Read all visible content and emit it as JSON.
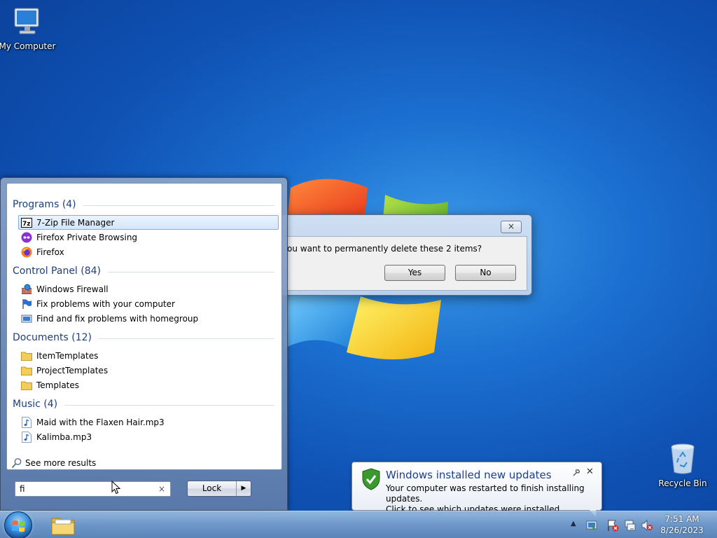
{
  "desktop": {
    "icons": [
      {
        "label": "My Computer"
      },
      {
        "label": "Recycle Bin"
      }
    ]
  },
  "dialog": {
    "message": "ou want to permanently delete these 2 items?",
    "yes_label": "Yes",
    "no_label": "No",
    "close_glyph": "×"
  },
  "start_menu": {
    "groups": [
      {
        "header": "Programs (4)",
        "items": [
          {
            "label": "7-Zip File Manager",
            "icon": "7zip-icon",
            "selected": true
          },
          {
            "label": "Firefox Private Browsing",
            "icon": "firefox-private-icon"
          },
          {
            "label": "Firefox",
            "icon": "firefox-icon"
          }
        ]
      },
      {
        "header": "Control Panel (84)",
        "items": [
          {
            "label": "Windows Firewall",
            "icon": "firewall-icon"
          },
          {
            "label": "Fix problems with your computer",
            "icon": "flag-icon"
          },
          {
            "label": "Find and fix problems with homegroup",
            "icon": "troubleshoot-icon"
          }
        ]
      },
      {
        "header": "Documents (12)",
        "items": [
          {
            "label": "ItemTemplates",
            "icon": "folder-icon"
          },
          {
            "label": "ProjectTemplates",
            "icon": "folder-icon"
          },
          {
            "label": "Templates",
            "icon": "folder-icon"
          }
        ]
      },
      {
        "header": "Music (4)",
        "items": [
          {
            "label": "Maid with the Flaxen Hair.mp3",
            "icon": "music-file-icon"
          },
          {
            "label": "Kalimba.mp3",
            "icon": "music-file-icon"
          }
        ]
      }
    ],
    "see_more": "See more results",
    "search_value": "fi",
    "clear_glyph": "×",
    "lock_label": "Lock",
    "lock_arrow": "▶"
  },
  "notification": {
    "title": "Windows installed new updates",
    "line1": "Your computer was restarted to finish installing updates.",
    "line2": "Click to see which updates were installed.",
    "close_glyph": "✕"
  },
  "taskbar": {
    "time": "7:51 AM",
    "date": "8/26/2023",
    "tray_chevron": "▲"
  },
  "colors": {
    "desktop_blue": "#1b6fd0",
    "group_header": "#1e3f7a",
    "notification_title": "#1e3f8f"
  }
}
